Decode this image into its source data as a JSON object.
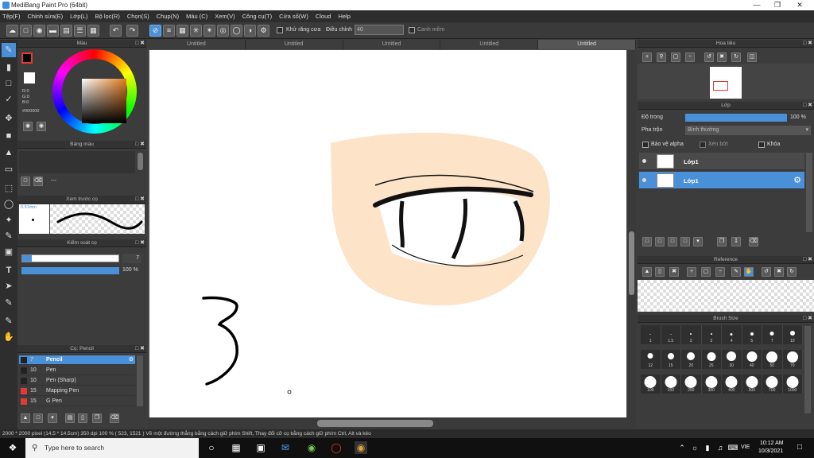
{
  "title": "MediBang Paint Pro (64bit)",
  "menu": [
    "Tệp(F)",
    "Chỉnh sửa(E)",
    "Lớp(L)",
    "Bộ lọc(R)",
    "Chọn(S)",
    "Chụp(N)",
    "Màu (C)",
    "Xem(V)",
    "Công cụ(T)",
    "Cửa sổ(W)",
    "Cloud",
    "Help"
  ],
  "toolbar": {
    "antialias_label": "Khử răng cưa",
    "adjust_label": "Điều chỉnh",
    "adjust_value": "40",
    "smooth_label": "Canh mềm"
  },
  "color_panel": {
    "title": "Màu",
    "r": "R:0",
    "g": "G:0",
    "b": "B:0",
    "hex": "#000000",
    "fg": "#000000",
    "bg": "#ffffff"
  },
  "palette_panel": {
    "title": "Bảng màu",
    "name": "---"
  },
  "brush_preview": {
    "title": "Xem trước cọ",
    "size": "0.51mm"
  },
  "brush_control": {
    "title": "Kiểm soát cọ",
    "size_value": "7",
    "opacity_value": "100 %"
  },
  "brush_list": {
    "title": "Cọ: Pencil",
    "items": [
      {
        "size": "7",
        "name": "Pencil",
        "color": "#222222",
        "active": true
      },
      {
        "size": "10",
        "name": "Pen",
        "color": "#222222"
      },
      {
        "size": "10",
        "name": "Pen (Sharp)",
        "color": "#222222"
      },
      {
        "size": "15",
        "name": "Mapping Pen",
        "color": "#e53935"
      },
      {
        "size": "15",
        "name": "G Pen",
        "color": "#e53935"
      }
    ]
  },
  "tabs": [
    "Untitled",
    "Untitled",
    "Untitled",
    "Untitled",
    "Untitled"
  ],
  "navigator": {
    "title": "Hoa tiêu"
  },
  "layer_panel": {
    "title": "Lớp",
    "opacity_label": "Độ trong",
    "opacity_value": "100 %",
    "opacity_fraction": 1.0,
    "blend_label": "Pha trộn",
    "blend_value": "Bình thường",
    "protect_alpha": "Bảo vệ alpha",
    "clipping": "Xén bớt",
    "lock": "Khóa",
    "layers": [
      {
        "name": "Lớp1",
        "active": false
      },
      {
        "name": "Lớp1",
        "active": true
      }
    ]
  },
  "reference": {
    "title": "Reference"
  },
  "brush_size": {
    "title": "Brush Size",
    "rows": [
      [
        "1",
        "1.5",
        "2",
        "3",
        "4",
        "5",
        "7",
        "10"
      ],
      [
        "12",
        "15",
        "20",
        "25",
        "30",
        "40",
        "50",
        "70"
      ],
      [
        "100",
        "150",
        "200",
        "300",
        "400",
        "500",
        "700",
        "1000"
      ]
    ]
  },
  "status": "2000 * 2000 pixel   (14.5 * 14.5cm)   350 dpi   100 %   ( 523, 1521 )   Vẽ một đường thẳng bằng cách giữ phím Shift, Thay đổi cỡ cọ bằng cách giữ phím Ctrl, Alt và kéo",
  "taskbar": {
    "search_placeholder": "Type here to search",
    "lang": "VIE",
    "time": "10:12 AM",
    "date": "10/3/2021"
  }
}
